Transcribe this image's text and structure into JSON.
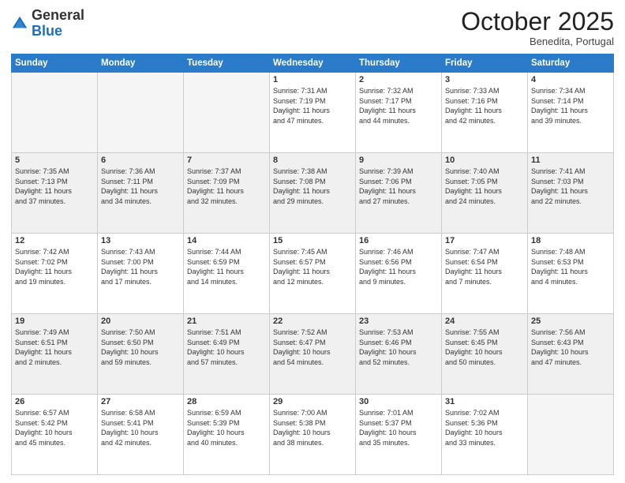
{
  "header": {
    "logo_general": "General",
    "logo_blue": "Blue",
    "month": "October 2025",
    "location": "Benedita, Portugal"
  },
  "days_of_week": [
    "Sunday",
    "Monday",
    "Tuesday",
    "Wednesday",
    "Thursday",
    "Friday",
    "Saturday"
  ],
  "weeks": [
    [
      {
        "day": "",
        "info": ""
      },
      {
        "day": "",
        "info": ""
      },
      {
        "day": "",
        "info": ""
      },
      {
        "day": "1",
        "info": "Sunrise: 7:31 AM\nSunset: 7:19 PM\nDaylight: 11 hours\nand 47 minutes."
      },
      {
        "day": "2",
        "info": "Sunrise: 7:32 AM\nSunset: 7:17 PM\nDaylight: 11 hours\nand 44 minutes."
      },
      {
        "day": "3",
        "info": "Sunrise: 7:33 AM\nSunset: 7:16 PM\nDaylight: 11 hours\nand 42 minutes."
      },
      {
        "day": "4",
        "info": "Sunrise: 7:34 AM\nSunset: 7:14 PM\nDaylight: 11 hours\nand 39 minutes."
      }
    ],
    [
      {
        "day": "5",
        "info": "Sunrise: 7:35 AM\nSunset: 7:13 PM\nDaylight: 11 hours\nand 37 minutes."
      },
      {
        "day": "6",
        "info": "Sunrise: 7:36 AM\nSunset: 7:11 PM\nDaylight: 11 hours\nand 34 minutes."
      },
      {
        "day": "7",
        "info": "Sunrise: 7:37 AM\nSunset: 7:09 PM\nDaylight: 11 hours\nand 32 minutes."
      },
      {
        "day": "8",
        "info": "Sunrise: 7:38 AM\nSunset: 7:08 PM\nDaylight: 11 hours\nand 29 minutes."
      },
      {
        "day": "9",
        "info": "Sunrise: 7:39 AM\nSunset: 7:06 PM\nDaylight: 11 hours\nand 27 minutes."
      },
      {
        "day": "10",
        "info": "Sunrise: 7:40 AM\nSunset: 7:05 PM\nDaylight: 11 hours\nand 24 minutes."
      },
      {
        "day": "11",
        "info": "Sunrise: 7:41 AM\nSunset: 7:03 PM\nDaylight: 11 hours\nand 22 minutes."
      }
    ],
    [
      {
        "day": "12",
        "info": "Sunrise: 7:42 AM\nSunset: 7:02 PM\nDaylight: 11 hours\nand 19 minutes."
      },
      {
        "day": "13",
        "info": "Sunrise: 7:43 AM\nSunset: 7:00 PM\nDaylight: 11 hours\nand 17 minutes."
      },
      {
        "day": "14",
        "info": "Sunrise: 7:44 AM\nSunset: 6:59 PM\nDaylight: 11 hours\nand 14 minutes."
      },
      {
        "day": "15",
        "info": "Sunrise: 7:45 AM\nSunset: 6:57 PM\nDaylight: 11 hours\nand 12 minutes."
      },
      {
        "day": "16",
        "info": "Sunrise: 7:46 AM\nSunset: 6:56 PM\nDaylight: 11 hours\nand 9 minutes."
      },
      {
        "day": "17",
        "info": "Sunrise: 7:47 AM\nSunset: 6:54 PM\nDaylight: 11 hours\nand 7 minutes."
      },
      {
        "day": "18",
        "info": "Sunrise: 7:48 AM\nSunset: 6:53 PM\nDaylight: 11 hours\nand 4 minutes."
      }
    ],
    [
      {
        "day": "19",
        "info": "Sunrise: 7:49 AM\nSunset: 6:51 PM\nDaylight: 11 hours\nand 2 minutes."
      },
      {
        "day": "20",
        "info": "Sunrise: 7:50 AM\nSunset: 6:50 PM\nDaylight: 10 hours\nand 59 minutes."
      },
      {
        "day": "21",
        "info": "Sunrise: 7:51 AM\nSunset: 6:49 PM\nDaylight: 10 hours\nand 57 minutes."
      },
      {
        "day": "22",
        "info": "Sunrise: 7:52 AM\nSunset: 6:47 PM\nDaylight: 10 hours\nand 54 minutes."
      },
      {
        "day": "23",
        "info": "Sunrise: 7:53 AM\nSunset: 6:46 PM\nDaylight: 10 hours\nand 52 minutes."
      },
      {
        "day": "24",
        "info": "Sunrise: 7:55 AM\nSunset: 6:45 PM\nDaylight: 10 hours\nand 50 minutes."
      },
      {
        "day": "25",
        "info": "Sunrise: 7:56 AM\nSunset: 6:43 PM\nDaylight: 10 hours\nand 47 minutes."
      }
    ],
    [
      {
        "day": "26",
        "info": "Sunrise: 6:57 AM\nSunset: 5:42 PM\nDaylight: 10 hours\nand 45 minutes."
      },
      {
        "day": "27",
        "info": "Sunrise: 6:58 AM\nSunset: 5:41 PM\nDaylight: 10 hours\nand 42 minutes."
      },
      {
        "day": "28",
        "info": "Sunrise: 6:59 AM\nSunset: 5:39 PM\nDaylight: 10 hours\nand 40 minutes."
      },
      {
        "day": "29",
        "info": "Sunrise: 7:00 AM\nSunset: 5:38 PM\nDaylight: 10 hours\nand 38 minutes."
      },
      {
        "day": "30",
        "info": "Sunrise: 7:01 AM\nSunset: 5:37 PM\nDaylight: 10 hours\nand 35 minutes."
      },
      {
        "day": "31",
        "info": "Sunrise: 7:02 AM\nSunset: 5:36 PM\nDaylight: 10 hours\nand 33 minutes."
      },
      {
        "day": "",
        "info": ""
      }
    ]
  ]
}
